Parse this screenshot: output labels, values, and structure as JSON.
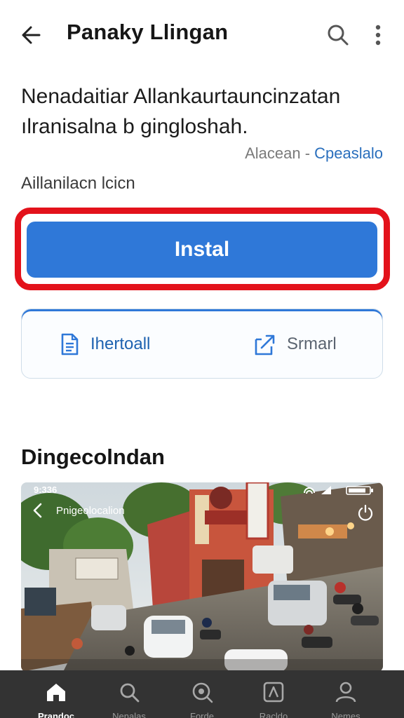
{
  "header": {
    "title": "Panaky Llingan",
    "back_icon": "arrow-left-icon",
    "search_icon": "search-icon",
    "more_icon": "more-vertical-icon"
  },
  "app": {
    "description_line1": "Nenadaitiar Allankaurtauncinzatan",
    "description_line2": "ılranisalna b gingloshah.",
    "meta_prefix": "Alacean -",
    "meta_link": "Cpeaslalo",
    "subtitle": "Aillanilacn lcicn"
  },
  "install": {
    "label": "Instal",
    "highlight_color": "#e3121b",
    "button_color": "#2f78d8"
  },
  "actions": [
    {
      "label": "Ihertoall",
      "icon": "document-icon"
    },
    {
      "label": "Srmarl",
      "icon": "share-icon"
    }
  ],
  "section": {
    "title": "Dingecolndan"
  },
  "screenshot": {
    "time": "9:336",
    "title": "Pnigeolocalion"
  },
  "bottom_nav": [
    {
      "label": "Prandoc",
      "icon": "home-icon",
      "active": true
    },
    {
      "label": "Nenalas",
      "icon": "search-icon",
      "active": false
    },
    {
      "label": "Forde",
      "icon": "discover-icon",
      "active": false
    },
    {
      "label": "Racldo",
      "icon": "apps-icon",
      "active": false
    },
    {
      "label": "Nemes",
      "icon": "profile-icon",
      "active": false
    }
  ]
}
